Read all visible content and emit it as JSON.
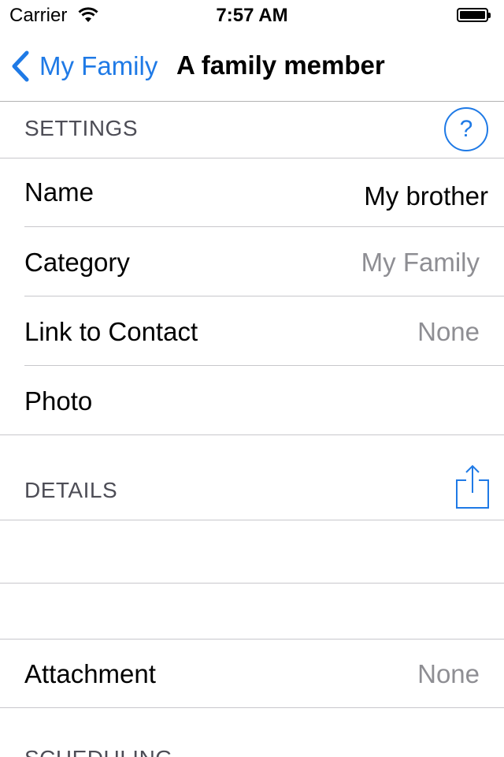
{
  "status_bar": {
    "carrier": "Carrier",
    "time": "7:57 AM",
    "battery_level": 1.0
  },
  "nav": {
    "back_label": "My Family",
    "title": "A family member"
  },
  "settings": {
    "header": "SETTINGS",
    "help_label": "?",
    "rows": [
      {
        "label": "Name",
        "value": "My brother"
      },
      {
        "label": "Category",
        "value": "My Family"
      },
      {
        "label": "Link to Contact",
        "value": "None"
      },
      {
        "label": "Photo",
        "value": ""
      }
    ]
  },
  "details": {
    "header": "DETAILS",
    "share_icon": "share-icon",
    "attachment_label": "Attachment",
    "attachment_value": "None"
  },
  "scheduling": {
    "header": "SCHEDULING"
  },
  "colors": {
    "accent": "#1f7ae6",
    "secondary_text": "#8e8e93",
    "header_text": "#4d4d56",
    "separator": "#c8c7cc"
  }
}
